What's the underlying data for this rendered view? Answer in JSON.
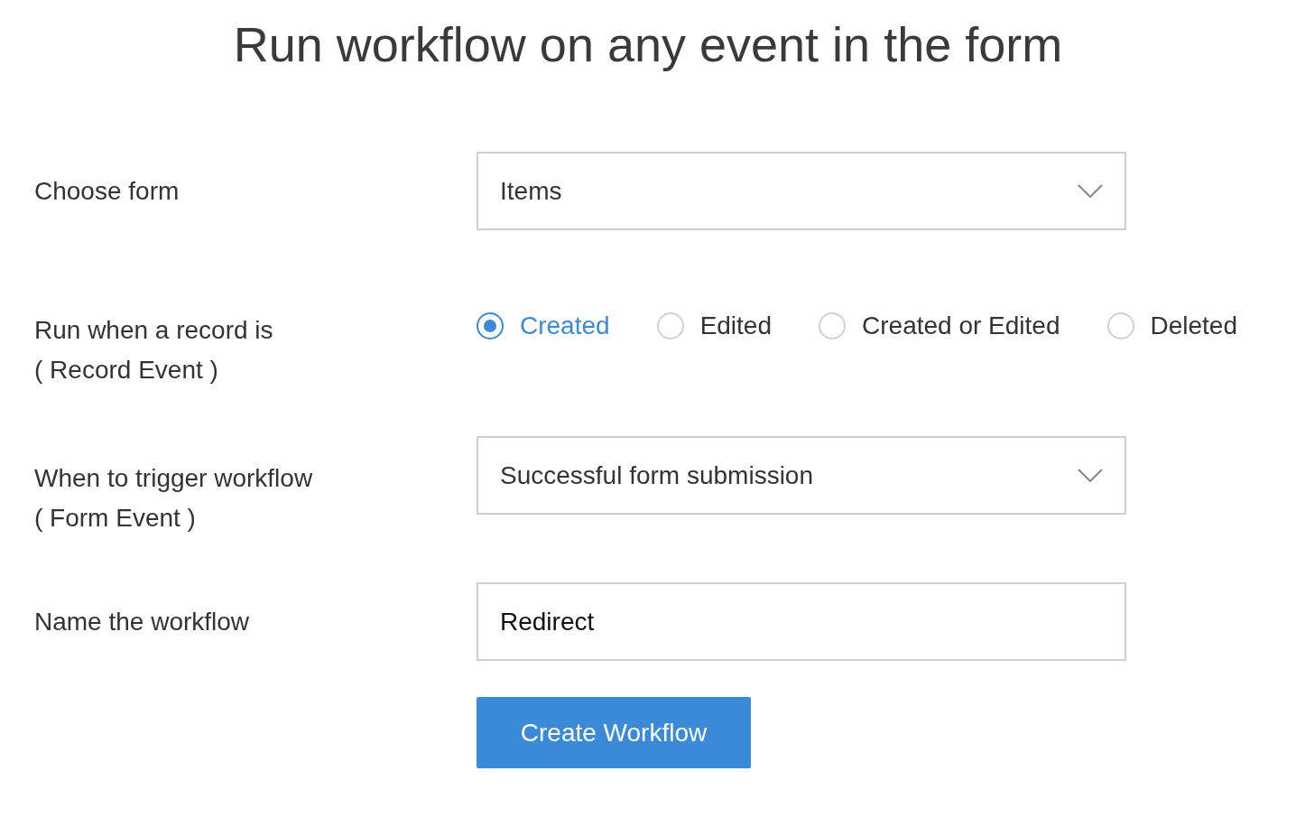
{
  "title": "Run workflow on any event in the form",
  "fields": [
    {
      "kind": "select",
      "label": "Choose form",
      "value": "Items"
    },
    {
      "kind": "radio",
      "label": "Run when a record is",
      "sublabel": "( Record Event )",
      "options": [
        {
          "label": "Created",
          "selected": true
        },
        {
          "label": "Edited",
          "selected": false
        },
        {
          "label": "Created or Edited",
          "selected": false
        },
        {
          "label": "Deleted",
          "selected": false
        }
      ]
    },
    {
      "kind": "select",
      "label": "When to trigger workflow",
      "sublabel": "( Form Event )",
      "value": "Successful form submission"
    },
    {
      "kind": "text",
      "label": "Name the workflow",
      "value": "Redirect"
    }
  ],
  "submit": "Create Workflow"
}
